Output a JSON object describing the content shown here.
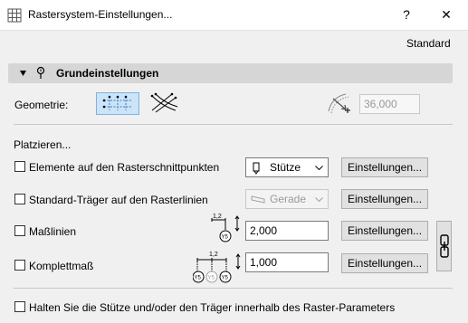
{
  "window": {
    "title": "Rastersystem-Einstellungen...",
    "help_label": "?",
    "close_label": "✕"
  },
  "header": {
    "preset": "Standard"
  },
  "section": {
    "title": "Grundeinstellungen"
  },
  "geometry": {
    "label": "Geometrie:",
    "angle_value": "36,000"
  },
  "place": {
    "label": "Platzieren..."
  },
  "rows": {
    "elements": {
      "label": "Elemente auf den Rasterschnittpunkten",
      "select": "Stütze",
      "button": "Einstellungen..."
    },
    "beams": {
      "label": "Standard-Träger auf den Rasterlinien",
      "select": "Gerade",
      "button": "Einstellungen..."
    },
    "dims": {
      "label": "Maßlinien",
      "value": "2,000",
      "button": "Einstellungen...",
      "icon_top": "1,2",
      "icon_badge": "Y5"
    },
    "overall": {
      "label": "Komplettmaß",
      "value": "1,000",
      "button": "Einstellungen...",
      "icon_top": "1,2",
      "icon_badges": [
        "Y5",
        "Y5",
        "Y5"
      ]
    }
  },
  "footer": {
    "hold_label": "Halten Sie die Stütze und/oder den Träger innerhalb des Raster-Parameters"
  },
  "colors": {
    "active_blue": "#cce4f7",
    "section_bg": "#d6d6d6"
  }
}
